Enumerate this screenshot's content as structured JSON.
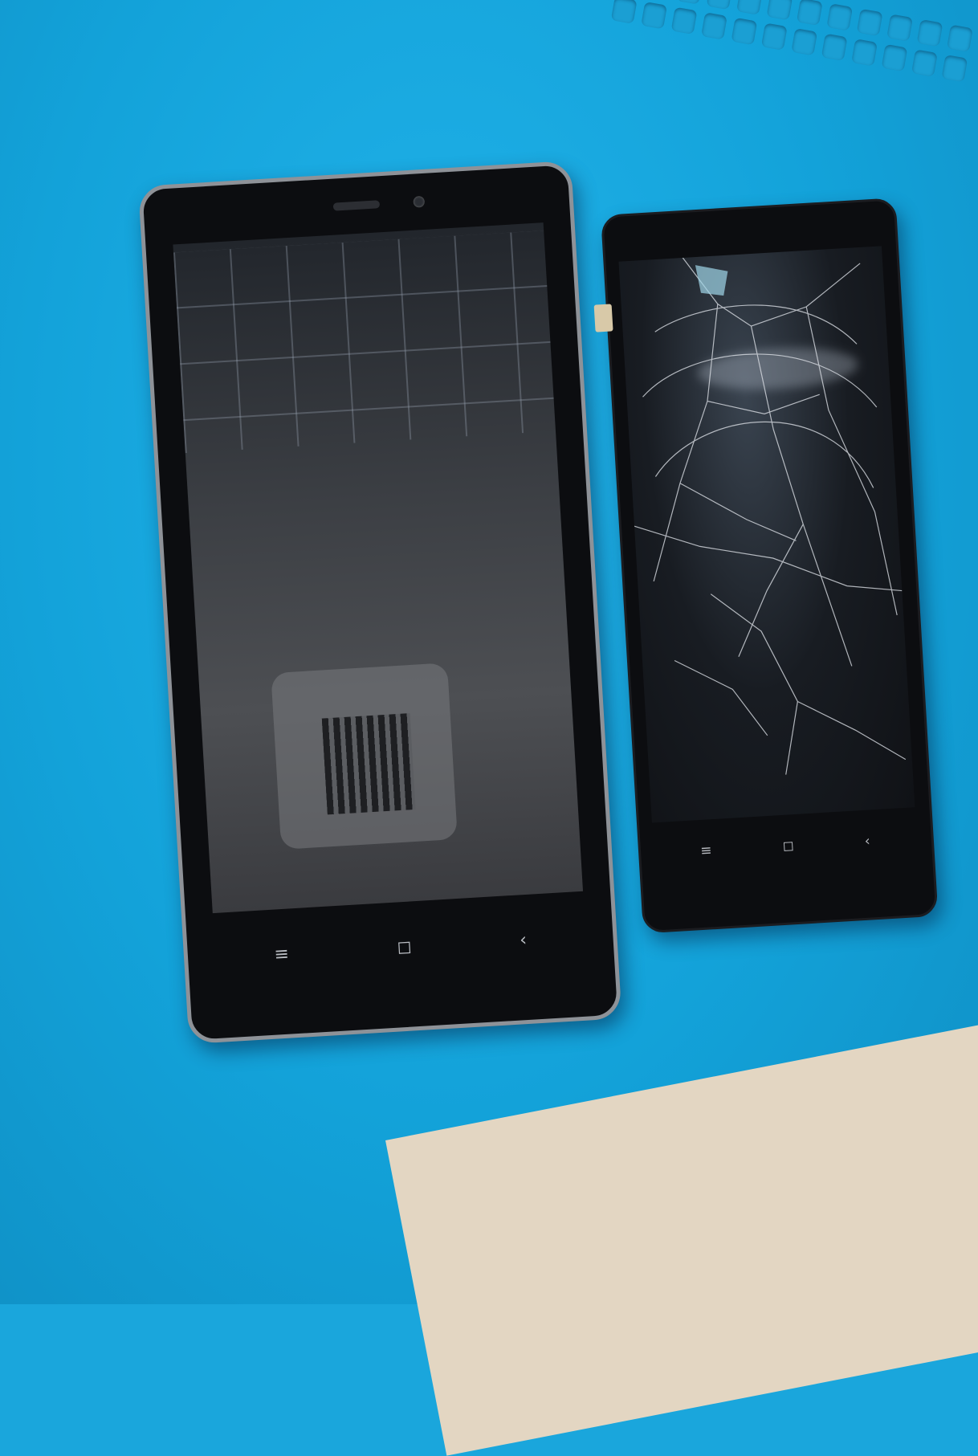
{
  "scene": {
    "colors": {
      "mat": "#1aa6dc",
      "phone_body": "#0c0d10",
      "frame": "#8e9298",
      "table": "#e3d6c2"
    },
    "left_phone": {
      "condition": "intact",
      "nav_menu_icon": "≡",
      "nav_home_icon": "◻",
      "nav_back_icon": "‹"
    },
    "right_phone": {
      "condition": "shattered",
      "nav_menu_icon": "≡",
      "nav_home_icon": "◻",
      "nav_back_icon": "‹"
    }
  }
}
